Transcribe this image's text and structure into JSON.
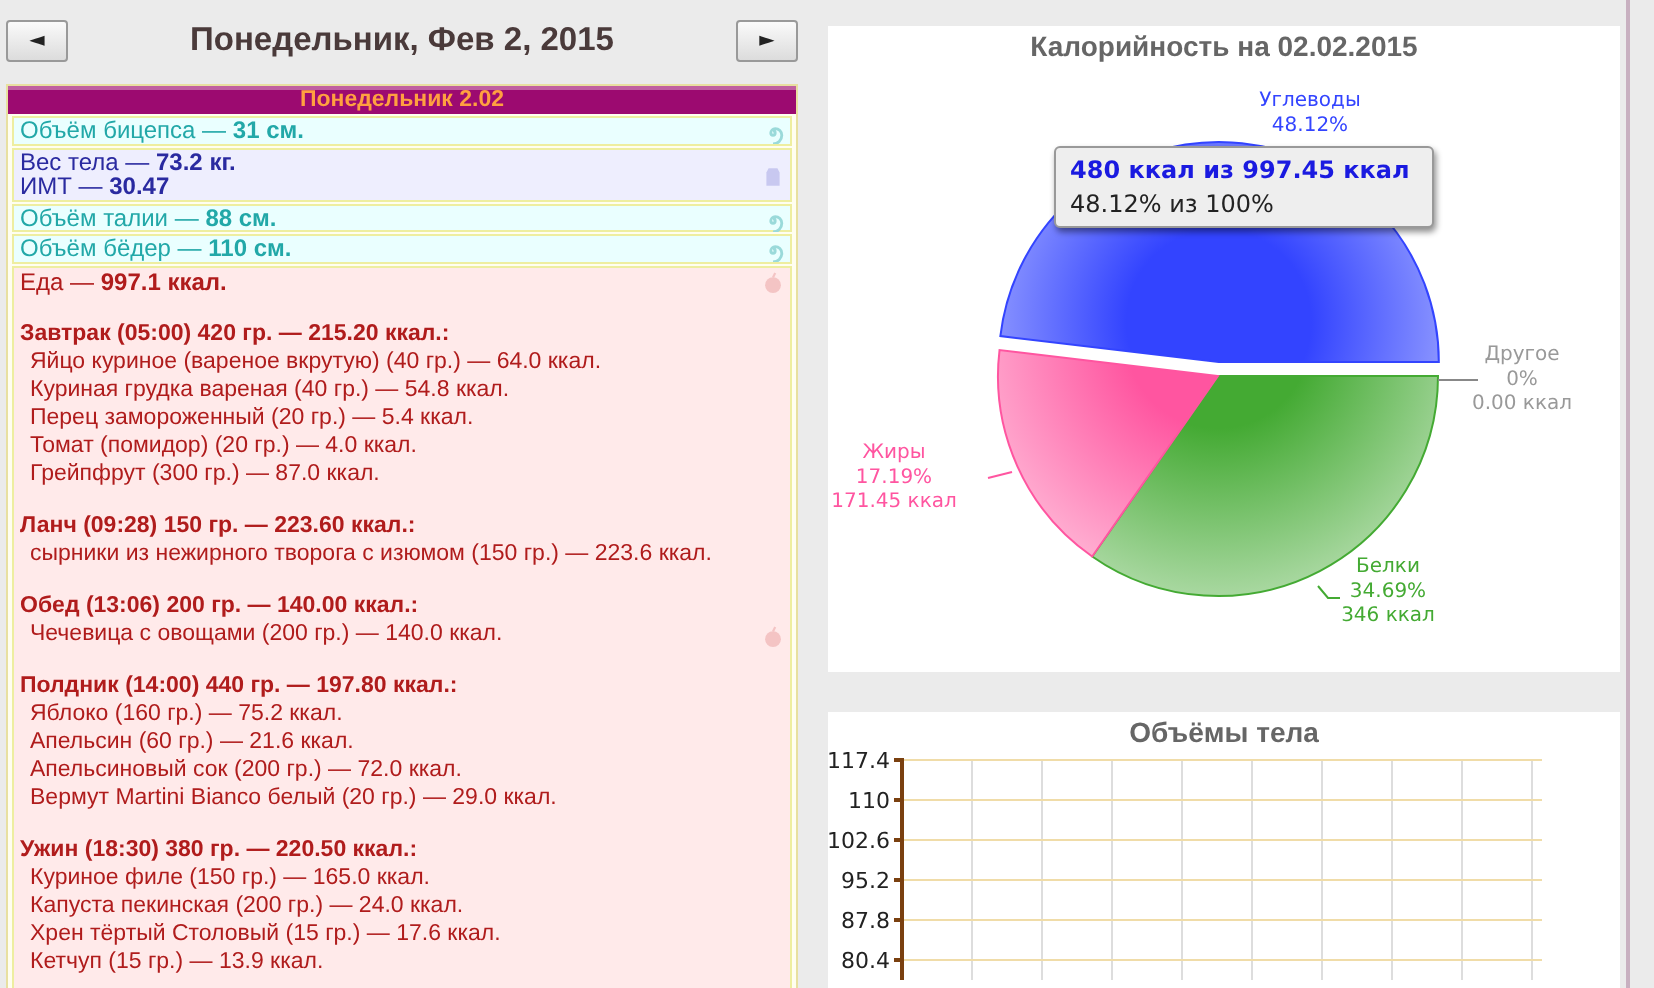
{
  "day_nav": {
    "prev": "◄",
    "title": "Понедельник, Фев 2, 2015",
    "next": "►"
  },
  "journal": {
    "header": "Понедельник 2.02",
    "entries": [
      {
        "kind": "measure",
        "lines": [
          "Объём бицепса — **31 см.**"
        ]
      },
      {
        "kind": "weight",
        "lines": [
          "Вес тела — **73.2 кг.**",
          "ИМТ — **30.47**"
        ]
      },
      {
        "kind": "measure",
        "lines": [
          "Объём талии — **88 см.**"
        ]
      },
      {
        "kind": "measure",
        "lines": [
          "Объём бёдер — **110 см.**"
        ]
      },
      {
        "kind": "food",
        "lines": [
          "Еда — **997.1 ккал.**"
        ],
        "meals": [
          {
            "heading": "Завтрак (05:00) 420 гр. — 215.20 ккал.:",
            "marked": false,
            "items": [
              "Яйцо куриное (вареное вкрутую) (40 гр.) — 64.0 ккал.",
              "Куриная грудка вареная (40 гр.) — 54.8 ккал.",
              "Перец замороженный (20 гр.) — 5.4 ккал.",
              "Томат (помидор) (20 гр.) — 4.0 ккал.",
              "Грейпфрут (300 гр.) — 87.0 ккал."
            ]
          },
          {
            "heading": "Ланч (09:28) 150 гр. — 223.60 ккал.:",
            "marked": false,
            "items": [
              "сырники из нежирного творога с изюмом (150 гр.) — 223.6 ккал."
            ]
          },
          {
            "heading": "Обед (13:06) 200 гр. — 140.00 ккал.:",
            "marked": true,
            "items": [
              "Чечевица с овощами (200 гр.) — 140.0 ккал."
            ]
          },
          {
            "heading": "Полдник (14:00) 440 гр. — 197.80 ккал.:",
            "marked": false,
            "items": [
              "Яблоко (160 гр.) — 75.2 ккал.",
              "Апельсин (60 гр.) — 21.6 ккал.",
              "Апельсиновый сок (200 гр.) — 72.0 ккал.",
              "Вермут Martini Bianco белый (20 гр.) — 29.0 ккал."
            ]
          },
          {
            "heading": "Ужин (18:30) 380 гр. — 220.50 ккал.:",
            "marked": false,
            "items": [
              "Куриное филе (150 гр.) — 165.0 ккал.",
              "Капуста пекинская (200 гр.) — 24.0 ккал.",
              "Хрен тёртый Столовый (15 гр.) — 17.6 ккал.",
              "Кетчуп (15 гр.) — 13.9 ккал."
            ]
          }
        ]
      }
    ]
  },
  "calories_chart": {
    "chart_data": {
      "type": "pie",
      "title": "Калорийность на 02.02.2015",
      "categories": [
        "Углеводы",
        "Другое",
        "Белки",
        "Жиры"
      ],
      "values": [
        48.12,
        0,
        34.69,
        17.19
      ],
      "data_labels": "value_labels",
      "value_labels": [
        "48.12%",
        "0%",
        "34.69%",
        "17.19%"
      ]
    },
    "labels": [
      {
        "color": "#3344ff"
      },
      {
        "kcal": "0.00 ккал",
        "color": "#999999"
      },
      {
        "kcal": "346 ккал",
        "color": "#44aa33"
      },
      {
        "kcal": "171.45 ккал",
        "color": "#ff55a0"
      }
    ],
    "tooltip": {
      "title": "480 ккал из 997.45 ккал",
      "text": "48.12% из 100%"
    }
  },
  "volumes_chart": {
    "chart_data": {
      "type": "line",
      "title": "Объёмы тела",
      "categories": [
        null,
        null,
        null,
        null,
        null,
        null,
        null,
        null,
        null
      ],
      "ylim": [
        76.7,
        117.4
      ],
      "grid": true,
      "yticks": [
        {
          "value": 117.4,
          "label": "117.4"
        },
        {
          "value": 110,
          "label": "110"
        },
        {
          "value": 102.6,
          "label": "102.6"
        },
        {
          "value": 95.2,
          "label": "95.2"
        },
        {
          "value": 87.8,
          "label": "87.8"
        },
        {
          "value": 80.4,
          "label": "80.4"
        }
      ]
    }
  }
}
